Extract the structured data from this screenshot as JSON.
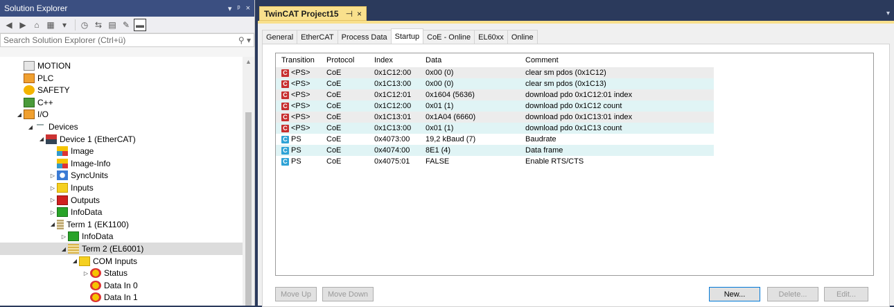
{
  "solution_explorer": {
    "title": "Solution Explorer",
    "title_dropdown": "▾",
    "pin": "ᵖ",
    "close": "×",
    "search_placeholder": "Search Solution Explorer (Ctrl+ü)",
    "search_icon": "⚲ ▾",
    "tree": [
      {
        "label": "MOTION",
        "icon": "motion-icon",
        "indent": 2,
        "exp": ""
      },
      {
        "label": "PLC",
        "icon": "plc-icon",
        "indent": 2,
        "exp": ""
      },
      {
        "label": "SAFETY",
        "icon": "safety-icon",
        "indent": 2,
        "exp": ""
      },
      {
        "label": "C++",
        "icon": "cpp-icon",
        "indent": 2,
        "exp": ""
      },
      {
        "label": "I/O",
        "icon": "io-icon",
        "indent": 2,
        "exp": "◢"
      },
      {
        "label": "Devices",
        "icon": "devices-icon",
        "indent": 3,
        "exp": "◢"
      },
      {
        "label": "Device 1 (EtherCAT)",
        "icon": "ethercat-device-icon",
        "indent": 4,
        "exp": "◢"
      },
      {
        "label": "Image",
        "icon": "image-icon",
        "indent": 5,
        "exp": ""
      },
      {
        "label": "Image-Info",
        "icon": "image-info-icon",
        "indent": 5,
        "exp": ""
      },
      {
        "label": "SyncUnits",
        "icon": "syncunits-icon",
        "indent": 5,
        "exp": "▷"
      },
      {
        "label": "Inputs",
        "icon": "inputs-icon",
        "indent": 5,
        "exp": "▷"
      },
      {
        "label": "Outputs",
        "icon": "outputs-icon",
        "indent": 5,
        "exp": "▷"
      },
      {
        "label": "InfoData",
        "icon": "infodata-icon",
        "indent": 5,
        "exp": "▷"
      },
      {
        "label": "Term 1 (EK1100)",
        "icon": "terminal-icon",
        "indent": 5,
        "exp": "◢"
      },
      {
        "label": "InfoData",
        "icon": "infodata-icon",
        "indent": 6,
        "exp": "▷"
      },
      {
        "label": "Term 2 (EL6001)",
        "icon": "terminal-el6001-icon",
        "indent": 6,
        "exp": "◢",
        "selected": true
      },
      {
        "label": "COM Inputs",
        "icon": "folder-inputs-icon",
        "indent": 7,
        "exp": "◢"
      },
      {
        "label": "Status",
        "icon": "variable-icon",
        "indent": 8,
        "exp": "▷"
      },
      {
        "label": "Data In 0",
        "icon": "variable-icon",
        "indent": 8,
        "exp": ""
      },
      {
        "label": "Data In 1",
        "icon": "variable-icon",
        "indent": 8,
        "exp": ""
      }
    ]
  },
  "document": {
    "tab_title": "TwinCAT Project15",
    "tab_pin": "⊣",
    "tab_close": "×",
    "dropdown": "▾",
    "tabs": [
      "General",
      "EtherCAT",
      "Process Data",
      "Startup",
      "CoE - Online",
      "EL60xx",
      "Online"
    ],
    "active_tab": "Startup",
    "columns": [
      "Transition",
      "Protocol",
      "Index",
      "Data",
      "Comment"
    ],
    "rows": [
      {
        "kind": "C",
        "color": "red",
        "transition": "<PS>",
        "protocol": "CoE",
        "index": "0x1C12:00",
        "data": "0x00 (0)",
        "comment": "clear sm pdos (0x1C12)"
      },
      {
        "kind": "C",
        "color": "red",
        "transition": "<PS>",
        "protocol": "CoE",
        "index": "0x1C13:00",
        "data": "0x00 (0)",
        "comment": "clear sm pdos (0x1C13)"
      },
      {
        "kind": "C",
        "color": "red",
        "transition": "<PS>",
        "protocol": "CoE",
        "index": "0x1C12:01",
        "data": "0x1604 (5636)",
        "comment": "download pdo 0x1C12:01 index"
      },
      {
        "kind": "C",
        "color": "red",
        "transition": "<PS>",
        "protocol": "CoE",
        "index": "0x1C12:00",
        "data": "0x01 (1)",
        "comment": "download pdo 0x1C12 count"
      },
      {
        "kind": "C",
        "color": "red",
        "transition": "<PS>",
        "protocol": "CoE",
        "index": "0x1C13:01",
        "data": "0x1A04 (6660)",
        "comment": "download pdo 0x1C13:01 index"
      },
      {
        "kind": "C",
        "color": "red",
        "transition": "<PS>",
        "protocol": "CoE",
        "index": "0x1C13:00",
        "data": "0x01 (1)",
        "comment": "download pdo 0x1C13 count"
      },
      {
        "kind": "C",
        "color": "blue",
        "transition": "PS",
        "protocol": "CoE",
        "index": "0x4073:00",
        "data": "19,2 kBaud (7)",
        "comment": "Baudrate"
      },
      {
        "kind": "C",
        "color": "blue",
        "transition": "PS",
        "protocol": "CoE",
        "index": "0x4074:00",
        "data": "8E1 (4)",
        "comment": "Data frame"
      },
      {
        "kind": "C",
        "color": "blue",
        "transition": "PS",
        "protocol": "CoE",
        "index": "0x4075:01",
        "data": "FALSE",
        "comment": "Enable RTS/CTS"
      }
    ],
    "buttons": {
      "move_up": "Move Up",
      "move_down": "Move Down",
      "new": "New...",
      "delete": "Delete...",
      "edit": "Edit..."
    }
  }
}
